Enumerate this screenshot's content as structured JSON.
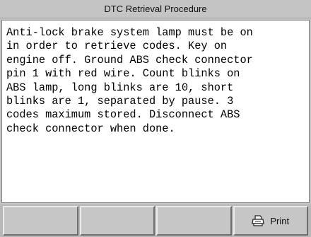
{
  "window": {
    "title": "DTC Retrieval Procedure"
  },
  "content": {
    "text": "Anti-lock brake system lamp must be on\nin order to retrieve codes. Key on\nengine off. Ground ABS check connector\npin 1 with red wire. Count blinks on\nABS lamp, long blinks are 10, short\nblinks are 1, separated by pause. 3\ncodes maximum stored. Disconnect ABS\ncheck connector when done."
  },
  "soft_keys": [
    {
      "label": "",
      "icon": ""
    },
    {
      "label": "",
      "icon": ""
    },
    {
      "label": "",
      "icon": ""
    },
    {
      "label": "Print",
      "icon": "printer-icon"
    }
  ]
}
